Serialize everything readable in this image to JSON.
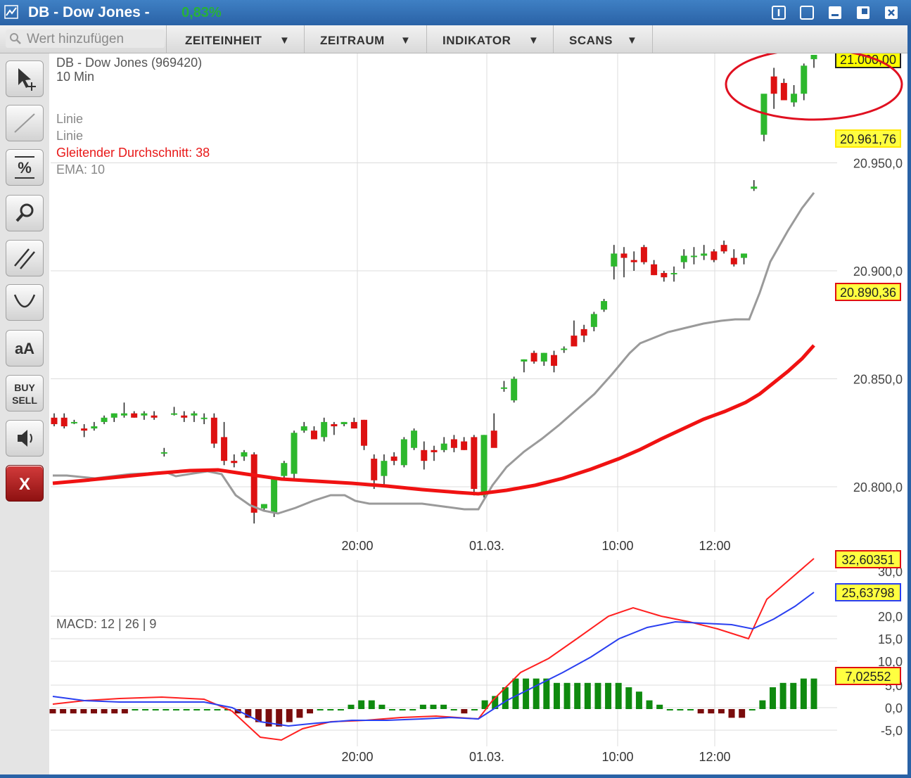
{
  "window": {
    "title": "DB - Dow Jones -",
    "change": "0,83%"
  },
  "toolbar": {
    "search_placeholder": "Wert hinzufügen",
    "menus": [
      "ZEITEINHEIT",
      "ZEITRAUM",
      "INDIKATOR",
      "SCANS"
    ]
  },
  "tools": [
    "pointer-icon",
    "line-icon",
    "percent-icon",
    "zoom-icon",
    "parallel-lines-icon",
    "arc-icon",
    "text-size-icon",
    "buy-sell-icon",
    "speaker-icon",
    "close-icon"
  ],
  "tool_labels": {
    "text_size": "aA",
    "buy": "BUY",
    "sell": "SELL",
    "close": "X"
  },
  "colors": {
    "up": "#2db82d",
    "down": "#dd1111",
    "sma": "#f01212",
    "ema": "#9a9a9a",
    "macd": "#ff2020",
    "signal": "#2a3ff0",
    "hist_pos": "#0f8a0f",
    "hist_neg": "#7a0c0c"
  },
  "chart_data": {
    "type": "candlestick",
    "instrument": "DB - Dow Jones (969420)",
    "interval": "10 Min",
    "legend": [
      "Linie",
      "Linie",
      "Gleitender Durchschnitt: 38",
      "EMA: 10"
    ],
    "y_ticks": [
      "20.950,0",
      "20.900,0",
      "20.850,0",
      "20.800,0"
    ],
    "ylim": [
      20780,
      21000
    ],
    "x_ticks": [
      "20:00",
      "01.03.",
      "10:00",
      "12:00"
    ],
    "price_labels": [
      "21.000,00",
      "20.961,76",
      "20.890,36"
    ],
    "candles": [
      [
        20832,
        20834,
        20828,
        20829
      ],
      [
        20832,
        20834,
        20827,
        20828
      ],
      [
        20830,
        20831,
        20829,
        20830
      ],
      [
        20827,
        20829,
        20823,
        20826
      ],
      [
        20827,
        20830,
        20826,
        20828
      ],
      [
        20830,
        20833,
        20829,
        20832
      ],
      [
        20832,
        20834,
        20830,
        20834
      ],
      [
        20833,
        20839,
        20832,
        20834
      ],
      [
        20834,
        20835,
        20832,
        20832
      ],
      [
        20833,
        20835,
        20831,
        20834
      ],
      [
        20833,
        20835,
        20831,
        20832
      ],
      [
        20816,
        20818,
        20814,
        20816
      ],
      [
        20834,
        20837,
        20833,
        20834
      ],
      [
        20833,
        20835,
        20830,
        20832
      ],
      [
        20833,
        20835,
        20830,
        20834
      ],
      [
        20832,
        20834,
        20829,
        20832
      ],
      [
        20832,
        20834,
        20818,
        20820
      ],
      [
        20823,
        20830,
        20810,
        20812
      ],
      [
        20812,
        20815,
        20809,
        20811
      ],
      [
        20814,
        20817,
        20812,
        20816
      ],
      [
        20815,
        20816,
        20783,
        20788
      ],
      [
        20790,
        20792,
        20789,
        20792
      ],
      [
        20788,
        20804,
        20786,
        20804
      ],
      [
        20805,
        20812,
        20803,
        20811
      ],
      [
        20806,
        20826,
        20804,
        20825
      ],
      [
        20826,
        20830,
        20825,
        20828
      ],
      [
        20826,
        20828,
        20822,
        20822
      ],
      [
        20823,
        20832,
        20821,
        20830
      ],
      [
        20829,
        20830,
        20824,
        20828
      ],
      [
        20829,
        20830,
        20828,
        20830
      ],
      [
        20830,
        20832,
        20827,
        20827
      ],
      [
        20831,
        20831,
        20817,
        20819
      ],
      [
        20813,
        20815,
        20799,
        20803
      ],
      [
        20805,
        20815,
        20800,
        20812
      ],
      [
        20814,
        20816,
        20810,
        20812
      ],
      [
        20810,
        20823,
        20809,
        20822
      ],
      [
        20818,
        20827,
        20817,
        20826
      ],
      [
        20817,
        20821,
        20808,
        20812
      ],
      [
        20817,
        20819,
        20812,
        20816
      ],
      [
        20817,
        20823,
        20816,
        20820
      ],
      [
        20822,
        20824,
        20816,
        20818
      ],
      [
        20821,
        20823,
        20817,
        20817
      ],
      [
        20823,
        20824,
        20796,
        20799
      ],
      [
        20796,
        20824,
        20795,
        20824
      ],
      [
        20826,
        20834,
        20819,
        20818
      ],
      [
        20846,
        20849,
        20844,
        20846
      ],
      [
        20840,
        20851,
        20839,
        20850
      ],
      [
        20858,
        20859,
        20853,
        20859
      ],
      [
        20862,
        20863,
        20857,
        20858
      ],
      [
        20858,
        20862,
        20856,
        20862
      ],
      [
        20861,
        20863,
        20853,
        20856
      ],
      [
        20864,
        20865,
        20862,
        20864
      ],
      [
        20870,
        20877,
        20866,
        20865
      ],
      [
        20873,
        20875,
        20867,
        20870
      ],
      [
        20874,
        20881,
        20872,
        20880
      ],
      [
        20882,
        20887,
        20881,
        20886
      ],
      [
        20902,
        20912,
        20896,
        20908
      ],
      [
        20908,
        20911,
        20897,
        20906
      ],
      [
        20905,
        20909,
        20900,
        20904
      ],
      [
        20911,
        20912,
        20903,
        20904
      ],
      [
        20903,
        20905,
        20898,
        20898
      ],
      [
        20899,
        20900,
        20895,
        20897
      ],
      [
        20899,
        20902,
        20895,
        20899
      ],
      [
        20904,
        20910,
        20901,
        20907
      ],
      [
        20907,
        20911,
        20903,
        20907
      ],
      [
        20907,
        20912,
        20905,
        20908
      ],
      [
        20909,
        20910,
        20904,
        20905
      ],
      [
        20912,
        20914,
        20908,
        20909
      ],
      [
        20906,
        20910,
        20902,
        20903
      ],
      [
        20906,
        20908,
        20903,
        20908
      ],
      [
        20938,
        20942,
        20937,
        20939
      ],
      [
        20963,
        20972,
        20960,
        20982
      ],
      [
        20990,
        20994,
        20975,
        20982
      ],
      [
        20987,
        20989,
        20980,
        20979
      ],
      [
        20978,
        20986,
        20976,
        20982
      ],
      [
        20982,
        20996,
        20979,
        20995
      ],
      [
        20998,
        21000,
        20994,
        21000
      ]
    ],
    "ema10": [
      [
        75,
        600
      ],
      [
        95,
        600
      ],
      [
        115,
        602
      ],
      [
        135,
        604
      ],
      [
        160,
        601
      ],
      [
        185,
        598
      ],
      [
        210,
        597
      ],
      [
        235,
        595
      ],
      [
        250,
        601
      ],
      [
        275,
        597
      ],
      [
        295,
        594
      ],
      [
        315,
        598
      ],
      [
        335,
        628
      ],
      [
        355,
        642
      ],
      [
        375,
        650
      ],
      [
        395,
        654
      ],
      [
        420,
        646
      ],
      [
        445,
        636
      ],
      [
        470,
        628
      ],
      [
        490,
        628
      ],
      [
        505,
        636
      ],
      [
        525,
        640
      ],
      [
        545,
        640
      ],
      [
        570,
        640
      ],
      [
        600,
        640
      ],
      [
        630,
        644
      ],
      [
        660,
        648
      ],
      [
        680,
        648
      ],
      [
        700,
        614
      ],
      [
        720,
        588
      ],
      [
        745,
        566
      ],
      [
        770,
        548
      ],
      [
        795,
        528
      ],
      [
        820,
        506
      ],
      [
        845,
        484
      ],
      [
        870,
        456
      ],
      [
        895,
        426
      ],
      [
        910,
        412
      ],
      [
        930,
        404
      ],
      [
        950,
        396
      ],
      [
        975,
        390
      ],
      [
        1000,
        384
      ],
      [
        1025,
        380
      ],
      [
        1045,
        378
      ],
      [
        1065,
        378
      ],
      [
        1080,
        340
      ],
      [
        1095,
        296
      ],
      [
        1120,
        252
      ],
      [
        1140,
        220
      ],
      [
        1157,
        198
      ]
    ],
    "sma38": [
      [
        75,
        611
      ],
      [
        120,
        607
      ],
      [
        170,
        602
      ],
      [
        220,
        597
      ],
      [
        270,
        593
      ],
      [
        310,
        592
      ],
      [
        350,
        598
      ],
      [
        400,
        605
      ],
      [
        450,
        608
      ],
      [
        500,
        611
      ],
      [
        550,
        615
      ],
      [
        600,
        620
      ],
      [
        650,
        624
      ],
      [
        680,
        626
      ],
      [
        720,
        621
      ],
      [
        760,
        614
      ],
      [
        800,
        604
      ],
      [
        840,
        591
      ],
      [
        880,
        576
      ],
      [
        910,
        563
      ],
      [
        940,
        548
      ],
      [
        970,
        534
      ],
      [
        1000,
        520
      ],
      [
        1030,
        509
      ],
      [
        1060,
        496
      ],
      [
        1080,
        484
      ],
      [
        1100,
        468
      ],
      [
        1120,
        452
      ],
      [
        1140,
        434
      ],
      [
        1157,
        415
      ]
    ],
    "macd": {
      "label": "MACD: 12 | 26 | 9",
      "y_ticks": [
        "30,0",
        "20,0",
        "15,0",
        "10,0",
        "5,0",
        "0,0",
        "-5,0"
      ],
      "value_labels": [
        "32,60351",
        "25,63798",
        "7,02552"
      ],
      "histogram": [
        -1,
        -1,
        -1,
        -1,
        -1,
        -1,
        -1,
        -1,
        0,
        0,
        0,
        0,
        0,
        0,
        0,
        0,
        0,
        0,
        -1,
        -2,
        -3,
        -4,
        -4,
        -3,
        -2,
        -1,
        0,
        0,
        0,
        1,
        2,
        2,
        1,
        0,
        0,
        0,
        1,
        1,
        1,
        0,
        -1,
        0,
        2,
        3,
        5,
        7,
        7,
        7,
        7,
        6,
        6,
        6,
        6,
        6,
        6,
        6,
        5,
        4,
        2,
        1,
        0,
        0,
        0,
        -1,
        -1,
        -1,
        -2,
        -2,
        0,
        2,
        5,
        6,
        6,
        7,
        7
      ]
    }
  }
}
